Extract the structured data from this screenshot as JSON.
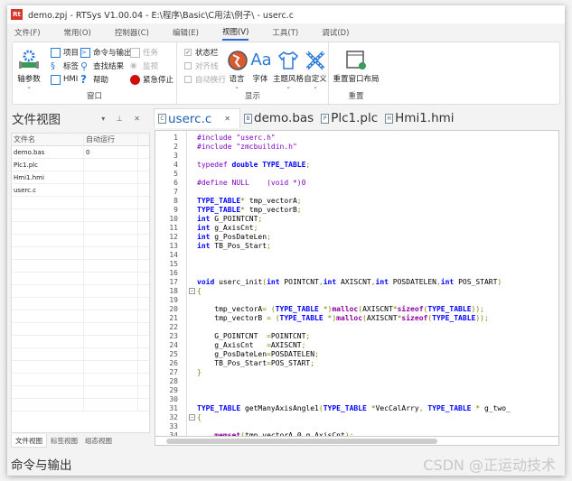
{
  "window": {
    "title": "demo.zpj - RTSys V1.00.04 - E:\\程序\\Basic\\C用法\\例子\\ - userc.c",
    "logo": "Rt"
  },
  "menu": [
    "文件(F)",
    "常用(O)",
    "控制器(C)",
    "编辑(E)",
    "视图(V)",
    "工具(T)",
    "调试(D)"
  ],
  "menu_active": 4,
  "ribbon": {
    "window_group": {
      "label": "窗口",
      "axis_param": "轴参数",
      "project": "项目",
      "label_item": "标签",
      "hmi": "HMI",
      "cmd_output": "命令与输出",
      "find_results": "查找结果",
      "help": "帮助",
      "task": "任务",
      "monitor": "监视",
      "emergency_stop": "紧急停止"
    },
    "display_group": {
      "label": "显示",
      "status_bar": "状态栏",
      "status_bar_checked": true,
      "align_line": "对齐线",
      "auto_wrap": "自动换行",
      "language": "语言",
      "font": "字体",
      "theme": "主题风格",
      "custom": "自定义"
    },
    "reset_group": {
      "label": "重置",
      "reset_layout": "重置窗口布局"
    }
  },
  "file_view": {
    "title": "文件视图",
    "columns": [
      "文件名",
      "自动运行"
    ],
    "rows": [
      [
        "demo.bas",
        "0"
      ],
      [
        "Plc1.plc",
        ""
      ],
      [
        "Hmi1.hmi",
        ""
      ],
      [
        "userc.c",
        ""
      ]
    ],
    "bottom_tabs": [
      "文件视图",
      "标签视图",
      "组态视图"
    ]
  },
  "editor_tabs": [
    {
      "label": "userc.c",
      "icon": "C"
    },
    {
      "label": "demo.bas",
      "icon": "B"
    },
    {
      "label": "Plc1.plc",
      "icon": "P"
    },
    {
      "label": "Hmi1.hmi",
      "icon": "H"
    }
  ],
  "code_lines": [
    [
      [
        "#include \"userc.h\"",
        "p"
      ]
    ],
    [
      [
        "#include \"zmcbuildin.h\"",
        "p"
      ]
    ],
    [],
    [
      [
        "typedef ",
        "p"
      ],
      [
        "double ",
        "k"
      ],
      [
        "TYPE_TABLE",
        "k"
      ],
      [
        ";",
        "o"
      ]
    ],
    [],
    [
      [
        "#define NULL    (void *)0",
        "p"
      ]
    ],
    [],
    [
      [
        "TYPE_TABLE",
        "k"
      ],
      [
        "*",
        "o"
      ],
      [
        " tmp_vectorA",
        "t"
      ],
      [
        ";",
        "o"
      ]
    ],
    [
      [
        "TYPE_TABLE",
        "k"
      ],
      [
        "*",
        "o"
      ],
      [
        " tmp_vectorB",
        "t"
      ],
      [
        ";",
        "o"
      ]
    ],
    [
      [
        "int ",
        "k"
      ],
      [
        "G_POINTCNT",
        "t"
      ],
      [
        ";",
        "o"
      ]
    ],
    [
      [
        "int ",
        "k"
      ],
      [
        "g_AxisCnt",
        "t"
      ],
      [
        ";",
        "o"
      ]
    ],
    [
      [
        "int ",
        "k"
      ],
      [
        "g_PosDateLen",
        "t"
      ],
      [
        ";",
        "o"
      ]
    ],
    [
      [
        "int ",
        "k"
      ],
      [
        "TB_Pos_Start",
        "t"
      ],
      [
        ";",
        "o"
      ]
    ],
    [],
    [],
    [],
    [
      [
        "void ",
        "k"
      ],
      [
        "userc_init",
        "t"
      ],
      [
        "(",
        "o"
      ],
      [
        "int ",
        "k"
      ],
      [
        "POINTCNT",
        "t"
      ],
      [
        ",",
        "o"
      ],
      [
        "int ",
        "k"
      ],
      [
        "AXISCNT",
        "t"
      ],
      [
        ",",
        "o"
      ],
      [
        "int ",
        "k"
      ],
      [
        "POSDATELEN",
        "t"
      ],
      [
        ",",
        "o"
      ],
      [
        "int ",
        "k"
      ],
      [
        "POS_START",
        "t"
      ],
      [
        ")",
        "o"
      ]
    ],
    [
      [
        "{",
        "o"
      ]
    ],
    [],
    [
      [
        "    tmp_vectorA",
        "t"
      ],
      [
        "= (",
        "o"
      ],
      [
        "TYPE_TABLE ",
        "k"
      ],
      [
        "*)",
        "o"
      ],
      [
        "malloc",
        "f"
      ],
      [
        "(",
        "o"
      ],
      [
        "AXISCNT",
        "t"
      ],
      [
        "*",
        "o"
      ],
      [
        "sizeof",
        "f"
      ],
      [
        "(",
        "o"
      ],
      [
        "TYPE_TABLE",
        "k"
      ],
      [
        "));",
        "o"
      ]
    ],
    [
      [
        "    tmp_vectorB ",
        "t"
      ],
      [
        "= (",
        "o"
      ],
      [
        "TYPE_TABLE ",
        "k"
      ],
      [
        "*)",
        "o"
      ],
      [
        "malloc",
        "f"
      ],
      [
        "(",
        "o"
      ],
      [
        "AXISCNT",
        "t"
      ],
      [
        "*",
        "o"
      ],
      [
        "sizeof",
        "f"
      ],
      [
        "(",
        "o"
      ],
      [
        "TYPE_TABLE",
        "k"
      ],
      [
        "));",
        "o"
      ]
    ],
    [],
    [
      [
        "    G_POINTCNT  ",
        "t"
      ],
      [
        "=",
        "o"
      ],
      [
        "POINTCNT",
        "t"
      ],
      [
        ";",
        "o"
      ]
    ],
    [
      [
        "    g_AxisCnt   ",
        "t"
      ],
      [
        "=",
        "o"
      ],
      [
        "AXISCNT",
        "t"
      ],
      [
        ";",
        "o"
      ]
    ],
    [
      [
        "    g_PosDateLen",
        "t"
      ],
      [
        "=",
        "o"
      ],
      [
        "POSDATELEN",
        "t"
      ],
      [
        ";",
        "o"
      ]
    ],
    [
      [
        "    TB_Pos_Start",
        "t"
      ],
      [
        "=",
        "o"
      ],
      [
        "POS_START",
        "t"
      ],
      [
        ";",
        "o"
      ]
    ],
    [
      [
        "}",
        "o"
      ]
    ],
    [],
    [],
    [],
    [
      [
        "TYPE_TABLE ",
        "k"
      ],
      [
        "getManyAxisAngle1",
        "t"
      ],
      [
        "(",
        "o"
      ],
      [
        "TYPE_TABLE ",
        "k"
      ],
      [
        "*",
        "o"
      ],
      [
        "VecCalArry",
        "t"
      ],
      [
        ", ",
        "o"
      ],
      [
        "TYPE_TABLE ",
        "k"
      ],
      [
        "* ",
        "o"
      ],
      [
        "g_two_",
        "t"
      ]
    ],
    [
      [
        "{",
        "o"
      ]
    ],
    [],
    [
      [
        "    memset",
        "f"
      ],
      [
        "(",
        "o"
      ],
      [
        "tmp_vectorA",
        "t"
      ],
      [
        ",",
        "o"
      ],
      [
        "0",
        "t"
      ],
      [
        ",",
        "o"
      ],
      [
        "g_AxisCnt",
        "t"
      ],
      [
        ");",
        "o"
      ]
    ]
  ],
  "fold_lines": [
    18,
    32
  ],
  "status": {
    "text": "命令与输出",
    "watermark": "CSDN @正运动技术"
  },
  "colors": {
    "keyword": "#0000ff",
    "preprocessor": "#8000c0",
    "operator": "#808000",
    "accent": "#1a5fb4"
  }
}
